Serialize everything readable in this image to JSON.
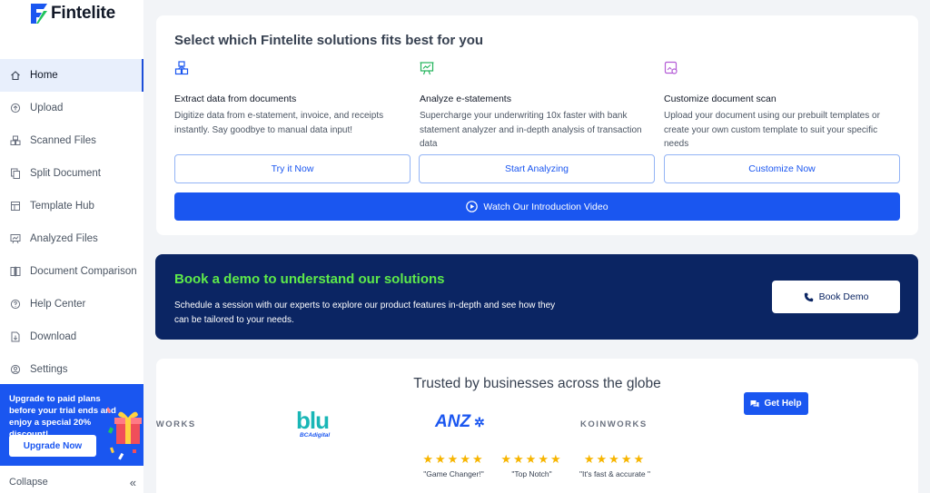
{
  "app": {
    "name": "Fintelite"
  },
  "sidebar": {
    "items": [
      {
        "label": "Home",
        "icon": "home-icon",
        "active": true
      },
      {
        "label": "Upload",
        "icon": "upload-icon"
      },
      {
        "label": "Scanned Files",
        "icon": "scanned-files-icon"
      },
      {
        "label": "Split Document",
        "icon": "split-document-icon"
      },
      {
        "label": "Template Hub",
        "icon": "template-hub-icon"
      },
      {
        "label": "Analyzed Files",
        "icon": "analyzed-files-icon"
      },
      {
        "label": "Document Comparison",
        "icon": "document-comparison-icon"
      },
      {
        "label": "Help Center",
        "icon": "help-center-icon"
      },
      {
        "label": "Download",
        "icon": "download-icon"
      },
      {
        "label": "Settings",
        "icon": "settings-icon"
      }
    ],
    "upgrade": {
      "text": "Upgrade to paid plans before your trial ends and enjoy a special 20% discount!",
      "button": "Upgrade Now"
    },
    "collapse_label": "Collapse",
    "collapse_icon": "«"
  },
  "solutions": {
    "title": "Select which Fintelite solutions fits best for you",
    "columns": [
      {
        "icon": "cubes-icon",
        "title": "Extract data from documents",
        "desc": "Digitize data from e-statement, invoice, and receipts instantly. Say goodbye to manual data input!",
        "button": "Try it Now"
      },
      {
        "icon": "presentation-chart-icon",
        "title": "Analyze e-statements",
        "desc": "Supercharge your underwriting 10x faster with bank statement analyzer and in-depth analysis of transaction data",
        "button": "Start Analyzing"
      },
      {
        "icon": "document-scan-icon",
        "title": "Customize document scan",
        "desc": "Upload your document using our prebuilt templates or create your own custom template to suit your specific needs",
        "button": "Customize Now"
      }
    ],
    "video_button": "Watch Our Introduction Video"
  },
  "demo": {
    "title": "Book a demo to understand our solutions",
    "desc": "Schedule a session with our experts to explore our product features in-depth and see how they can be tailored to your needs.",
    "button": "Book Demo"
  },
  "trusted": {
    "title": "Trusted by businesses across the globe",
    "logos": [
      "KOINWORKS",
      "blu",
      "BCAdigital",
      "ANZ",
      "KOINWORKS"
    ],
    "reviews": [
      {
        "stars": "★★★★★",
        "quote": "\"Game Changer!\""
      },
      {
        "stars": "★★★★★",
        "quote": "\"Top Notch\""
      },
      {
        "stars": "★★★★★",
        "quote": "\"It's fast & accurate \""
      }
    ],
    "help_button": "Get Help"
  },
  "colors": {
    "accent": "#1a56f0",
    "banner": "#0b2563",
    "banner_title": "#5eea4a",
    "star": "#f7b500"
  }
}
